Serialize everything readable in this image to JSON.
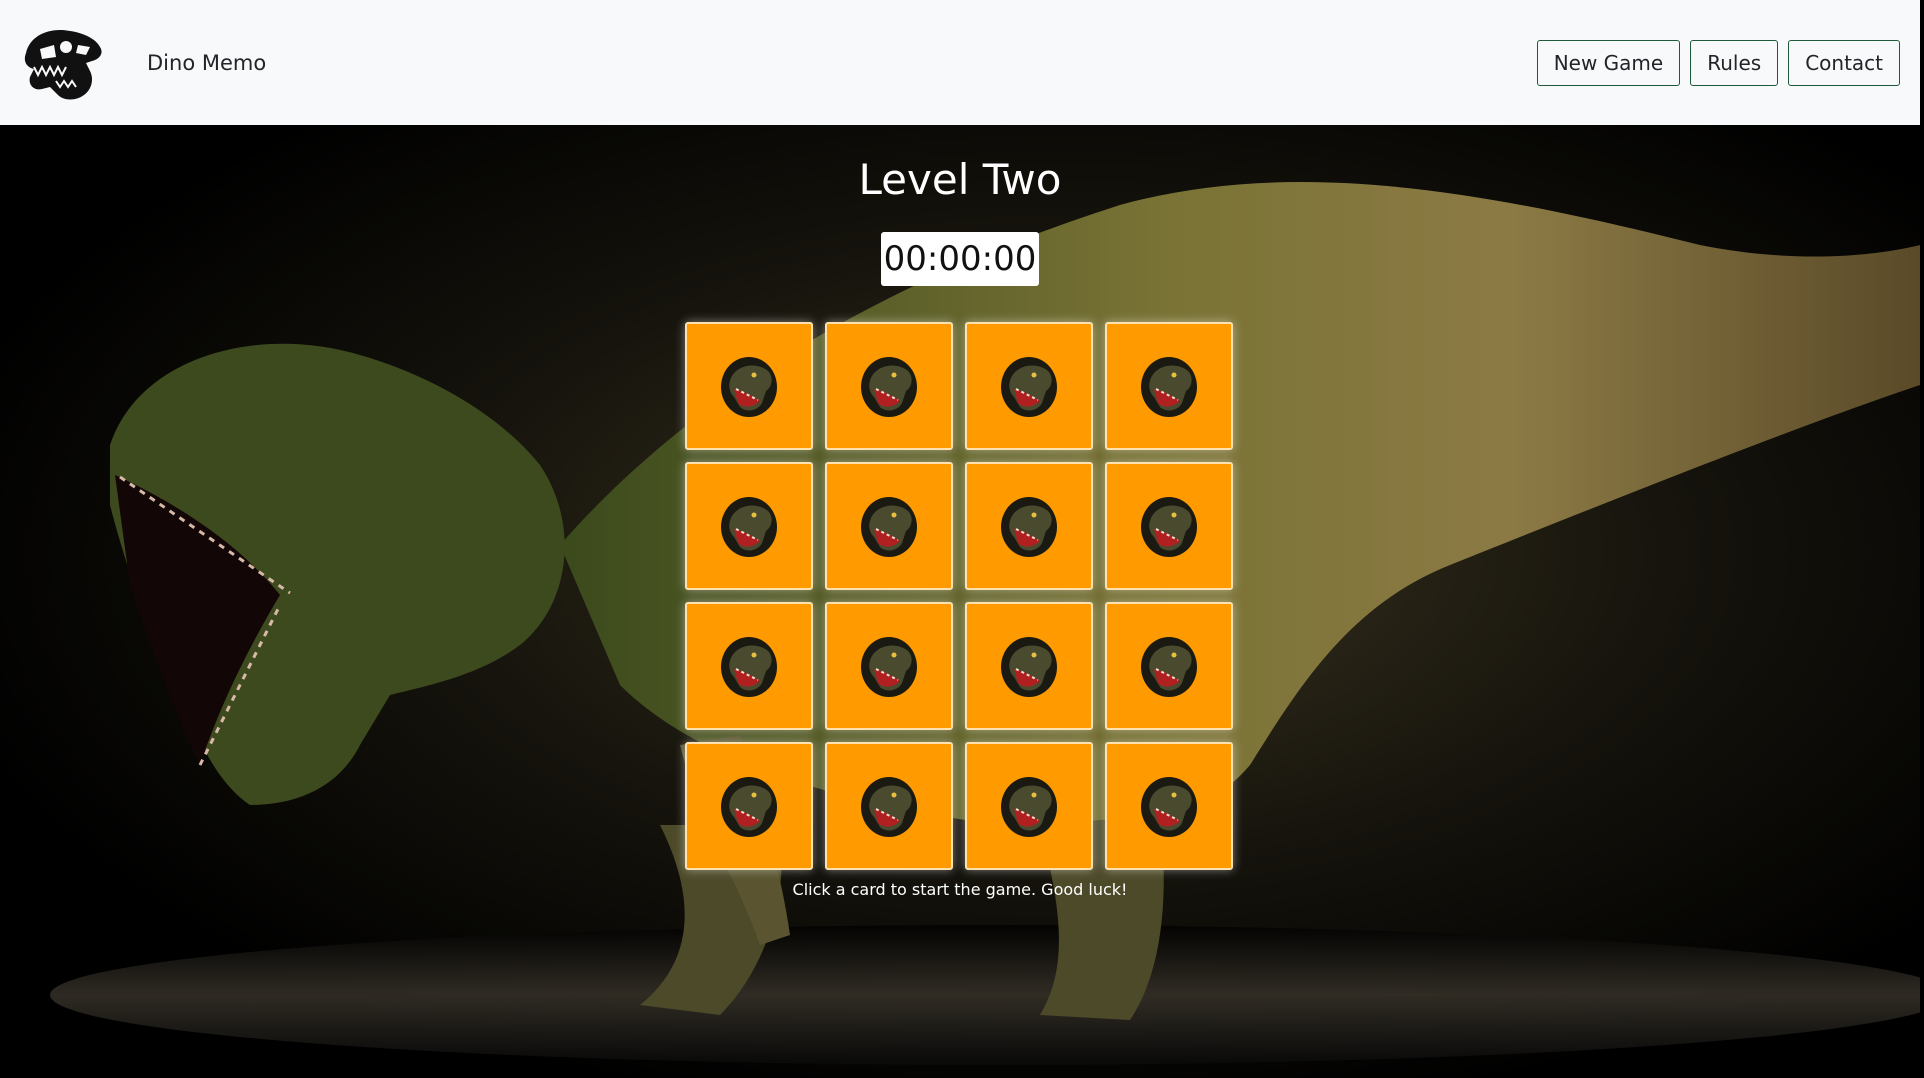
{
  "navbar": {
    "logo_icon": "dino-skull-icon",
    "brand_name": "Dino Memo",
    "buttons": {
      "new_game": "New Game",
      "rules": "Rules",
      "contact": "Contact"
    },
    "button_border_color": "#1e5a3a"
  },
  "game": {
    "level_title": "Level Two",
    "timer": "00:00:00",
    "card_back_color": "#ff9a00",
    "card_back_icon": "t-rex-head-icon",
    "card_count": 16,
    "grid_columns": 4,
    "hint": "Click a card to start the game. Good luck!"
  },
  "background": {
    "image_subject": "t-rex-illustration"
  }
}
